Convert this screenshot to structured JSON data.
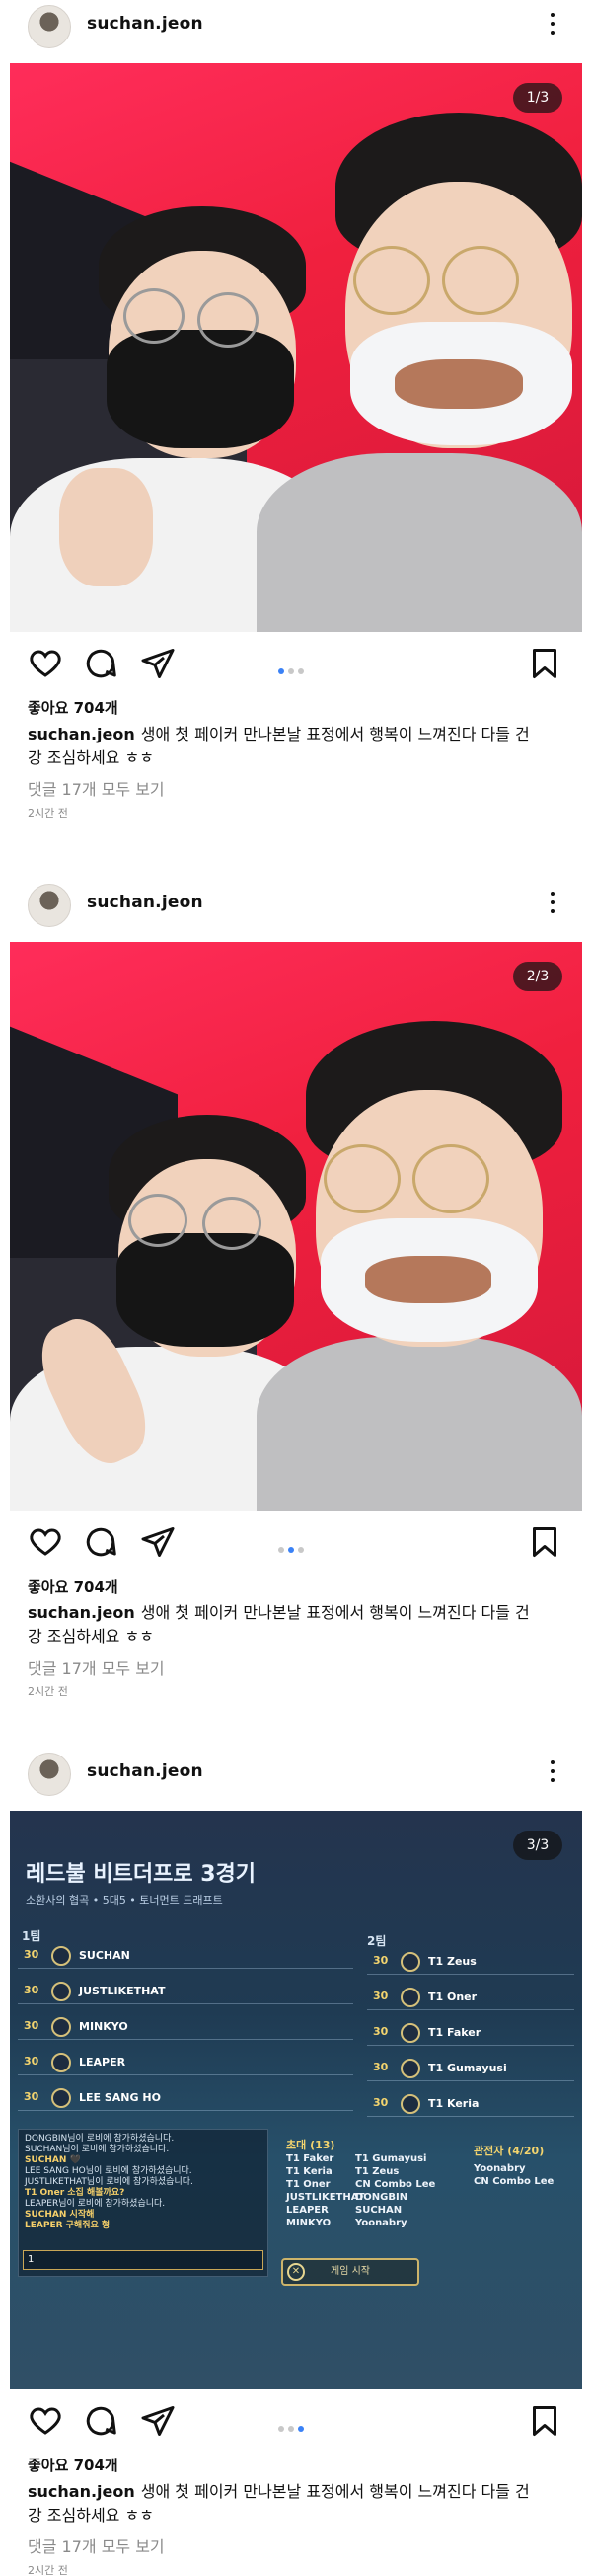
{
  "posts": [
    {
      "username": "suchan.jeon",
      "counter": "1/3",
      "likes": "좋아요 704개",
      "caption_user": "suchan.jeon",
      "caption_text": "생애 첫 페이커 만나본날 표정에서 행복이 느껴진다 다들 건강 조심하세요 ㅎㅎ",
      "comments": "댓글 17개 모두 보기",
      "time": "2시간 전",
      "active_dot": 1
    },
    {
      "username": "suchan.jeon",
      "counter": "2/3",
      "likes": "좋아요 704개",
      "caption_user": "suchan.jeon",
      "caption_text": "생애 첫 페이커 만나본날 표정에서 행복이 느껴진다 다들 건강 조심하세요 ㅎㅎ",
      "comments": "댓글 17개 모두 보기",
      "time": "2시간 전",
      "active_dot": 2
    },
    {
      "username": "suchan.jeon",
      "counter": "3/3",
      "likes": "좋아요 704개",
      "caption_user": "suchan.jeon",
      "caption_text": "생애 첫 페이커 만나본날 표정에서 행복이 느껴진다 다들 건강 조심하세요 ㅎㅎ",
      "comments": "댓글 17개 모두 보기",
      "time": "2시간 전",
      "active_dot": 3
    }
  ],
  "game": {
    "title": "레드불 비트더프로 3경기",
    "subtitle": "소환사의 협곡 • 5대5 • 토너먼트 드래프트",
    "team1_label": "1팀",
    "team2_label": "2팀",
    "team1": [
      {
        "level": "30",
        "name": "SUCHAN"
      },
      {
        "level": "30",
        "name": "JUSTLIKETHAT"
      },
      {
        "level": "30",
        "name": "MINKYO"
      },
      {
        "level": "30",
        "name": "LEAPER"
      },
      {
        "level": "30",
        "name": "LEE SANG HO"
      }
    ],
    "team2": [
      {
        "level": "30",
        "name": "T1 Zeus"
      },
      {
        "level": "30",
        "name": "T1 Oner"
      },
      {
        "level": "30",
        "name": "T1 Faker"
      },
      {
        "level": "30",
        "name": "T1 Gumayusi"
      },
      {
        "level": "30",
        "name": "T1 Keria"
      }
    ],
    "chat_lines": [
      {
        "text": "DONGBIN님이 로비에 참가하셨습니다.",
        "hl": false
      },
      {
        "text": "SUCHAN님이 로비에 참가하셨습니다.",
        "hl": false
      },
      {
        "text": "SUCHAN 🖤",
        "hl": true
      },
      {
        "text": "LEE SANG HO님이 로비에 참가하셨습니다.",
        "hl": false
      },
      {
        "text": "JUSTLIKETHAT님이 로비에 참가하셨습니다.",
        "hl": false
      },
      {
        "text": "T1 Oner 소집 해볼까요?",
        "hl": true
      },
      {
        "text": "LEAPER님이 로비에 참가하셨습니다.",
        "hl": false
      },
      {
        "text": "SUCHAN 시작해",
        "hl": true
      },
      {
        "text": "LEAPER 구해줘요 형",
        "hl": true
      }
    ],
    "chat_input": "1",
    "invite_label": "초대 (13)",
    "invite_col1": [
      "T1 Faker",
      "T1 Keria",
      "T1 Oner",
      "JUSTLIKETHAT",
      "LEAPER",
      "MINKYO"
    ],
    "invite_col2": [
      "T1 Gumayusi",
      "T1 Zeus",
      "CN Combo Lee",
      "DONGBIN",
      "SUCHAN",
      "Yoonabry"
    ],
    "spectator_label": "관전자 (4/20)",
    "spectators": [
      "Yoonabry",
      "CN Combo Lee"
    ],
    "start_button": "게임 시작"
  }
}
